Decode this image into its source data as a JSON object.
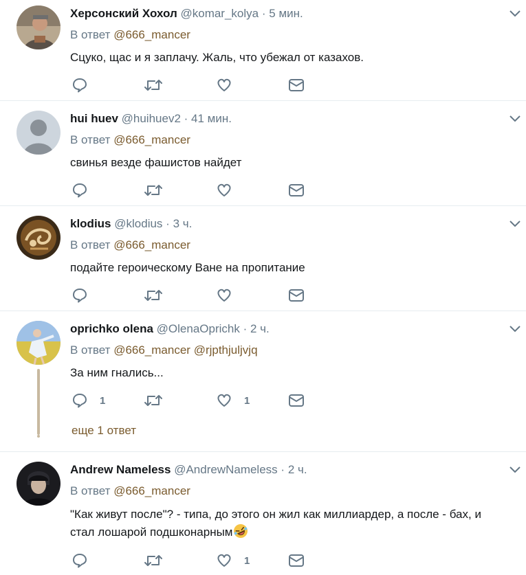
{
  "icons": {
    "reply": "speech-bubble-icon",
    "retweet": "retweet-icon",
    "like": "heart-icon",
    "dm": "envelope-icon",
    "menu": "chevron-down-icon"
  },
  "colors": {
    "text": "#14171a",
    "muted": "#657786",
    "link": "#7a5b2e",
    "divider": "#e6ecf0"
  },
  "tweets": [
    {
      "name": "Херсонский Хохол",
      "handle": "@komar_kolya",
      "dot": "·",
      "time": "5 мин.",
      "reply_prefix": "В ответ",
      "mentions": [
        "@666_mancer"
      ],
      "text": "Сцуко, щас и я заплачу. Жаль, что убежал от казахов."
    },
    {
      "name": "hui huev",
      "handle": "@huihuev2",
      "dot": "·",
      "time": "41 мин.",
      "reply_prefix": "В ответ",
      "mentions": [
        "@666_mancer"
      ],
      "text": "свинья везде фашистов найдет"
    },
    {
      "name": "klodius",
      "handle": "@klodius",
      "dot": "·",
      "time": "3 ч.",
      "reply_prefix": "В ответ",
      "mentions": [
        "@666_mancer"
      ],
      "text": "подайте героическому Ване на пропитание"
    },
    {
      "name": "oprichko olena",
      "handle": "@OlenaOprichk",
      "dot": "·",
      "time": "2 ч.",
      "reply_prefix": "В ответ",
      "mentions": [
        "@666_mancer",
        "@rjpthjuljvjq"
      ],
      "text": "За ним гнались...",
      "reply_count": "1",
      "like_count": "1",
      "more_replies": "еще 1 ответ"
    },
    {
      "name": "Andrew Nameless",
      "handle": "@AndrewNameless",
      "dot": "·",
      "time": "2 ч.",
      "reply_prefix": "В ответ",
      "mentions": [
        "@666_mancer"
      ],
      "text_line1": "\"Как живут после\"? - типа, до этого он жил как миллиардер, а после - бах, и",
      "text_line2": "стал лошарой подшконарным",
      "emoji": "rolling-on-floor-laughing-emoji",
      "like_count": "1"
    }
  ]
}
